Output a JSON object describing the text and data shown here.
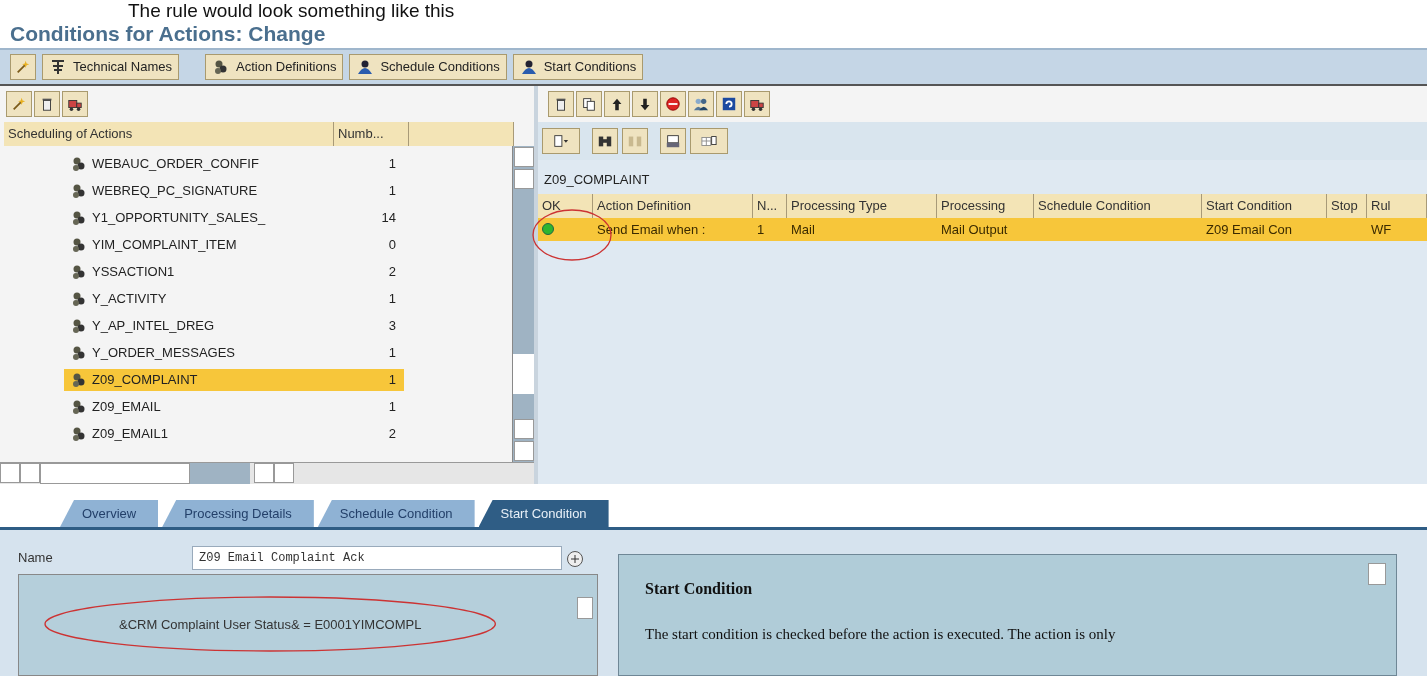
{
  "caption": "The rule would look something like this",
  "title": "Conditions for Actions: Change",
  "main_toolbar": [
    {
      "label": "Technical Names"
    },
    {
      "label": "Action Definitions"
    },
    {
      "label": "Schedule Conditions"
    },
    {
      "label": "Start Conditions"
    }
  ],
  "actions_tree": {
    "columns": [
      "Scheduling of Actions",
      "Numb..."
    ],
    "rows": [
      {
        "name": "WEBAUC_ORDER_CONFIF",
        "count": "1",
        "selected": false
      },
      {
        "name": "WEBREQ_PC_SIGNATURE",
        "count": "1",
        "selected": false
      },
      {
        "name": "Y1_OPPORTUNITY_SALES_",
        "count": "14",
        "selected": false
      },
      {
        "name": "YIM_COMPLAINT_ITEM",
        "count": "0",
        "selected": false
      },
      {
        "name": "YSSACTION1",
        "count": "2",
        "selected": false
      },
      {
        "name": "Y_ACTIVITY",
        "count": "1",
        "selected": false
      },
      {
        "name": "Y_AP_INTEL_DREG",
        "count": "3",
        "selected": false
      },
      {
        "name": "Y_ORDER_MESSAGES",
        "count": "1",
        "selected": false
      },
      {
        "name": "Z09_COMPLAINT",
        "count": "1",
        "selected": true
      },
      {
        "name": "Z09_EMAIL",
        "count": "1",
        "selected": false
      },
      {
        "name": "Z09_EMAIL1",
        "count": "2",
        "selected": false
      }
    ]
  },
  "conditions_table": {
    "profile": "Z09_COMPLAINT",
    "columns": [
      "OK",
      "Action Definition",
      "N...",
      "Processing Type",
      "Processing",
      "Schedule Condition",
      "Start Condition",
      "Stop",
      "Rul"
    ],
    "rows": [
      {
        "selected": true,
        "ok": true,
        "cells": [
          "",
          "Send Email when :",
          "1",
          "Mail",
          "Mail Output",
          "",
          "Z09 Email Con",
          "",
          "WF"
        ]
      }
    ]
  },
  "tabs": [
    {
      "label": "Overview",
      "selected": false
    },
    {
      "label": "Processing Details",
      "selected": false
    },
    {
      "label": "Schedule Condition",
      "selected": false
    },
    {
      "label": "Start Condition",
      "selected": true
    }
  ],
  "start_condition": {
    "name_label": "Name",
    "name_value": "Z09 Email Complaint Ack",
    "expression": "&CRM Complaint User Status& = E0001YIMCOMPL"
  },
  "help": {
    "title": "Start Condition",
    "text": "The start condition is checked before the action is executed. The action is only"
  }
}
